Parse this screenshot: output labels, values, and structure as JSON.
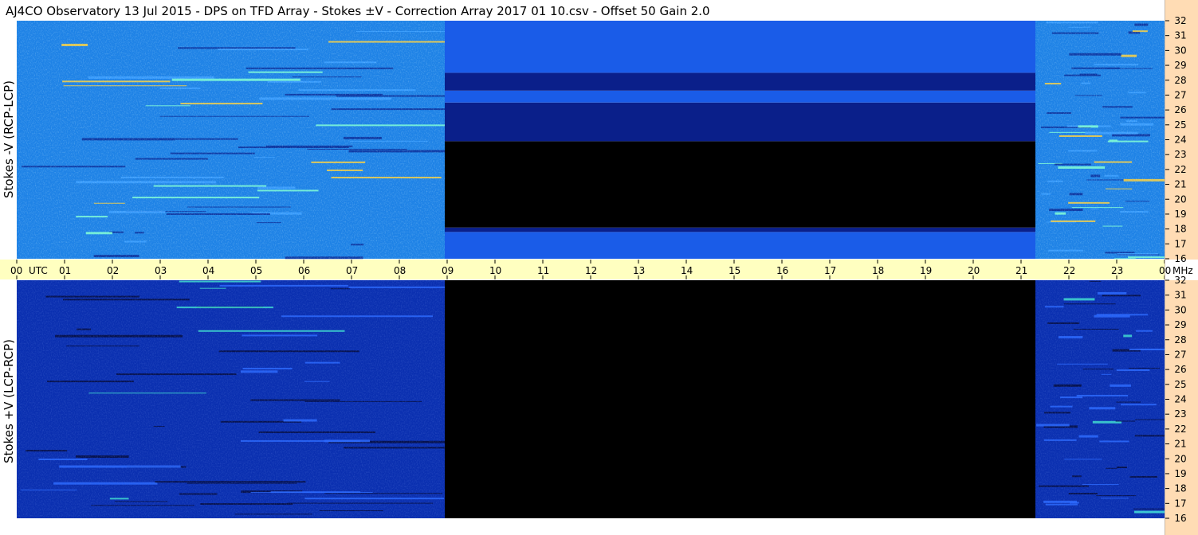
{
  "title": "AJ4CO Observatory  13 Jul 2015  -  DPS on TFD Array  -  Stokes ±V  -  Correction Array 2017 01 10.csv  -  Offset 50  Gain 2.0",
  "colors": {
    "background": "#ffffff",
    "time_axis_band": "#ffffc0",
    "freq_axis_band": "#ffdcb4",
    "spectrogram_base": "#1e82e6",
    "spectrogram_dark": "#0a2fb0",
    "gap": "#000000"
  },
  "chart_data": [
    {
      "type": "heatmap",
      "panel": "top",
      "ylabel": "Stokes -V (RCP-LCP)",
      "x_unit": "UTC",
      "y_unit": "MHz",
      "xlim": [
        0,
        24
      ],
      "ylim": [
        16,
        32
      ],
      "yticks": [
        "16",
        "17",
        "18",
        "19",
        "20",
        "21",
        "22",
        "23",
        "24",
        "25",
        "26",
        "27",
        "28",
        "29",
        "30",
        "31",
        "32"
      ],
      "data_coverage_utc": [
        [
          0,
          8.95
        ],
        [
          21.3,
          24
        ]
      ],
      "gap_utc": [
        8.95,
        21.3
      ],
      "gap_profile_mhz": [
        {
          "from": 16,
          "to": 17.8,
          "level": "blue"
        },
        {
          "from": 17.8,
          "to": 18.1,
          "level": "dark-blue"
        },
        {
          "from": 18.1,
          "to": 23.9,
          "level": "black"
        },
        {
          "from": 23.9,
          "to": 26.5,
          "level": "dark-blue"
        },
        {
          "from": 26.5,
          "to": 27.3,
          "level": "blue"
        },
        {
          "from": 27.3,
          "to": 28.5,
          "level": "dark-blue"
        },
        {
          "from": 28.5,
          "to": 32,
          "level": "blue"
        }
      ]
    },
    {
      "type": "heatmap",
      "panel": "bottom",
      "ylabel": "Stokes +V (LCP-RCP)",
      "x_unit": "UTC",
      "y_unit": "MHz",
      "xlim": [
        0,
        24
      ],
      "ylim": [
        16,
        32
      ],
      "yticks": [
        "16",
        "17",
        "18",
        "19",
        "20",
        "21",
        "22",
        "23",
        "24",
        "25",
        "26",
        "27",
        "28",
        "29",
        "30",
        "31",
        "32"
      ],
      "data_coverage_utc": [
        [
          0,
          8.95
        ],
        [
          21.3,
          24
        ]
      ],
      "gap_utc": [
        8.95,
        21.3
      ],
      "gap_profile_mhz": [
        {
          "from": 16,
          "to": 32,
          "level": "black"
        }
      ]
    }
  ],
  "time_axis": {
    "ticks": [
      "00",
      "01",
      "02",
      "03",
      "04",
      "05",
      "06",
      "07",
      "08",
      "09",
      "10",
      "11",
      "12",
      "13",
      "14",
      "15",
      "16",
      "17",
      "18",
      "19",
      "20",
      "21",
      "22",
      "23",
      "00"
    ],
    "utc_label": "UTC",
    "mhz_label": "MHz"
  }
}
